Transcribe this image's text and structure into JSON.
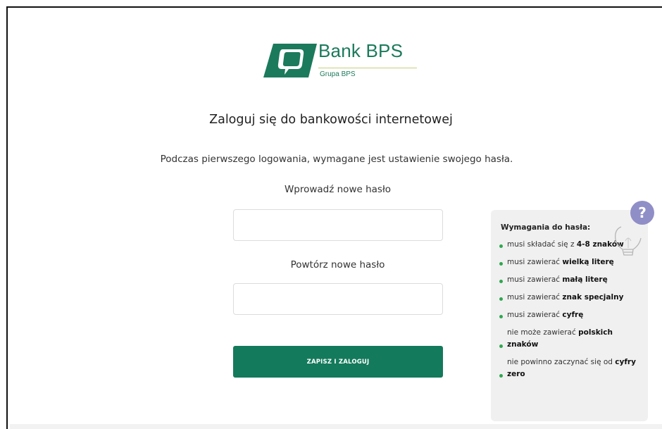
{
  "brand": {
    "name": "Bank BPS",
    "subtitle": "Grupa BPS",
    "colors": {
      "primary": "#137a5b",
      "accent_line": "#c8d07a",
      "bullet": "#2fa84f"
    }
  },
  "page": {
    "title": "Zaloguj się do bankowości internetowej",
    "subtitle": "Podczas pierwszego logowania, wymagane jest ustawienie swojego hasła."
  },
  "form": {
    "new_password_label": "Wprowadź nowe hasło",
    "new_password_value": "",
    "repeat_password_label": "Powtórz nowe hasło",
    "repeat_password_value": "",
    "submit_label": "ZAPISZ I ZALOGUJ"
  },
  "requirements": {
    "title": "Wymagania do hasła:",
    "items": [
      {
        "pre": "musi składać się z ",
        "bold": "4-8 znaków",
        "post": ""
      },
      {
        "pre": "musi zawierać ",
        "bold": "wielką literę",
        "post": ""
      },
      {
        "pre": "musi zawierać ",
        "bold": "małą literę",
        "post": ""
      },
      {
        "pre": "musi zawierać ",
        "bold": "znak specjalny",
        "post": ""
      },
      {
        "pre": "musi zawierać ",
        "bold": "cyfrę",
        "post": ""
      },
      {
        "pre": "nie może zawierać ",
        "bold": "polskich znaków",
        "post": ""
      },
      {
        "pre": "nie powinno zaczynać się od ",
        "bold": "cyfry zero",
        "post": ""
      }
    ]
  },
  "icons": {
    "logo": "bank-bps-logo-icon",
    "help": "lightbulb-question-icon"
  }
}
